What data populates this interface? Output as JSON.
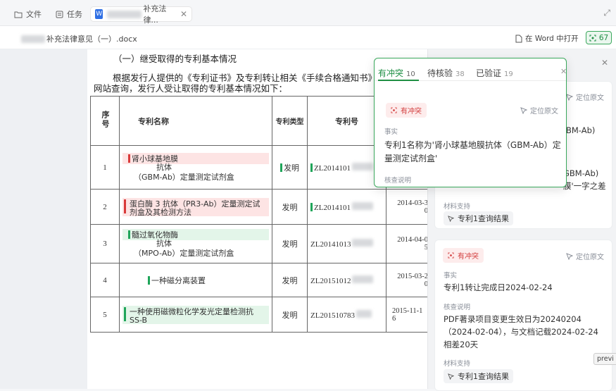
{
  "tabs": [
    {
      "label": "文件"
    },
    {
      "label": "任务"
    },
    {
      "label": "补充法律..."
    }
  ],
  "subbar": {
    "filename": "补充法律意见（一）.docx",
    "open_word": "在 Word 中打开",
    "count": "67"
  },
  "doc": {
    "heading": "（一）继受取得的专利基本情况",
    "para1": "根据发行人提供的《专利证书》及专利转让相关《手续合格通知书》",
    "para2": "网站查询，发行人受让取得的专利基本情况如下：",
    "table": {
      "headers": [
        "序号",
        "专利名称",
        "专利类型",
        "专利号"
      ],
      "rows": [
        {
          "no": "1",
          "name1": "肾小球基地膜",
          "name2": "抗体",
          "name3": "（GBM-Ab）定量测定试剂盒",
          "type": "发明",
          "patent_no": "ZL2014101",
          "date": ""
        },
        {
          "no": "2",
          "name1": "蛋白酶 3 抗体（PR3-Ab）定量测定试",
          "name2": "剂盒及其检测方法",
          "name3": "",
          "type": "发明",
          "patent_no": "ZL2014101",
          "date": "2014-03-30"
        },
        {
          "no": "3",
          "name1": "髓过氧化物酶",
          "name2": "抗体",
          "name3": "（MPO-Ab）定量测定试剂盒",
          "type": "发明",
          "patent_no": "ZL20141013",
          "date": "2014-04-05"
        },
        {
          "no": "4",
          "name1": "一种磁分离装置",
          "name2": "",
          "name3": "",
          "type": "发明",
          "patent_no": "ZL20151012",
          "date": "2015-03-20"
        },
        {
          "no": "5",
          "name1": "一种使用磁微粒化学发光定量检测抗",
          "name2": "SS-B",
          "name3": "",
          "type": "发明",
          "patent_no": "ZL201510783",
          "date": "2015-11-16"
        }
      ]
    }
  },
  "popup": {
    "tabs": [
      {
        "label": "有冲突",
        "count": "10"
      },
      {
        "label": "待核验",
        "count": "38"
      },
      {
        "label": "已验证",
        "count": "19"
      }
    ],
    "badge": "有冲突",
    "locate": "定位原文",
    "fact_label": "事实",
    "fact_text": "专利1名称为'肾小球基地膜抗体（GBM-Ab）定量测定试剂盒'",
    "check_label": "核查说明"
  },
  "panel": {
    "card1": {
      "locate": "定位原文",
      "frag1": "BM-Ab)",
      "frag2": "GBM-Ab)",
      "frag3": "膜'一字之差",
      "material_label": "材料支持",
      "chip": "专利1查询结果"
    },
    "card2": {
      "badge": "有冲突",
      "locate": "定位原文",
      "fact_label": "事实",
      "fact_text": "专利1转让完成日2024-02-24",
      "check_label": "核查说明",
      "check_text1": "PDF著录项目变更生效日为20240204",
      "check_text2": "（2024-02-04），与文档记载2024-02-24",
      "check_text3": "相差20天",
      "material_label": "材料支持",
      "chip": "专利1查询结果"
    },
    "preview_tag": "previ"
  }
}
